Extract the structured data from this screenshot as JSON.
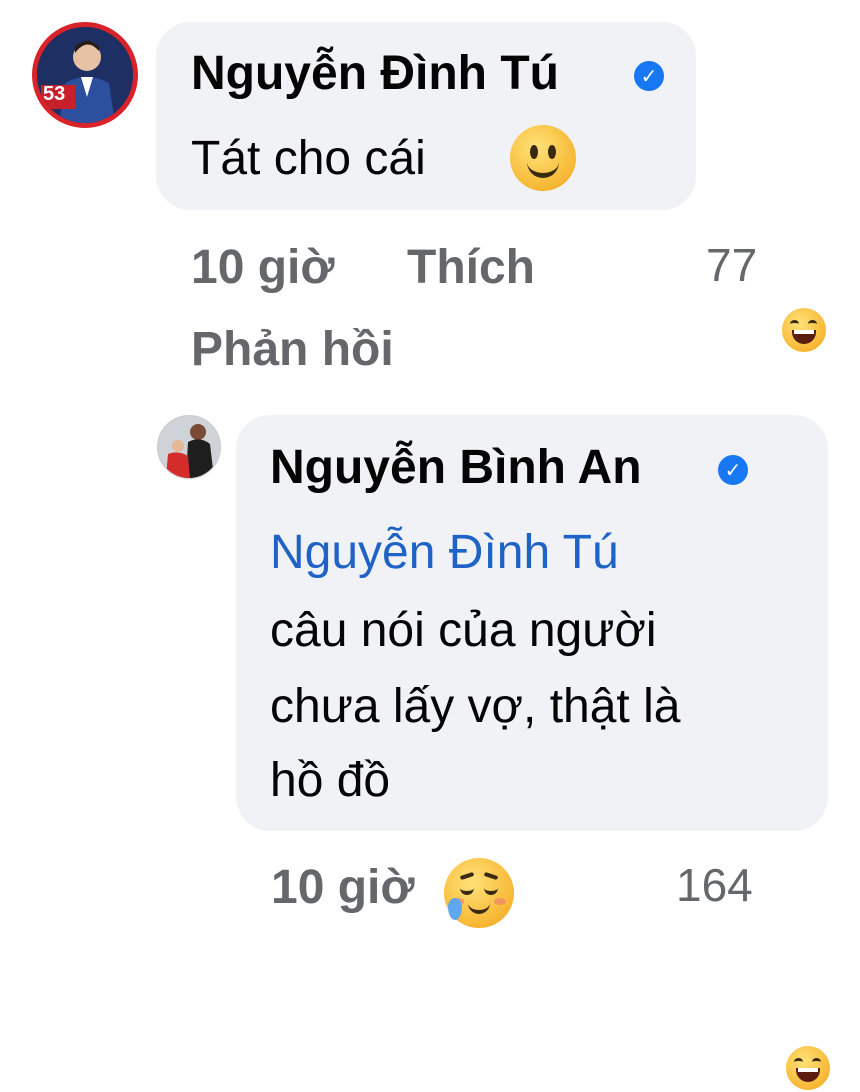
{
  "comment": {
    "author": "Nguyễn Đình Tú",
    "text": "Tát cho cái",
    "emoji": "slightly-smiling-face-icon",
    "time": "10 giờ",
    "like_label": "Thích",
    "reply_label": "Phản hồi",
    "reaction_count": "77",
    "reaction_icon": "laughing-face-icon",
    "avatar_badge": "53"
  },
  "reply": {
    "author": "Nguyễn Bình An",
    "mention": "Nguyễn Đình Tú",
    "text_line1": "câu nói của người",
    "text_line2": "chưa lấy vợ, thật là",
    "text_line3": "hồ đồ",
    "emoji": "face-holding-back-tears-icon",
    "time": "10 giờ",
    "reaction_count": "164",
    "reaction_icon": "laughing-face-icon"
  },
  "colors": {
    "bubble": "#f0f2f5",
    "mention": "#1f63c6",
    "meta": "#65676b",
    "verified": "#1877f2"
  }
}
